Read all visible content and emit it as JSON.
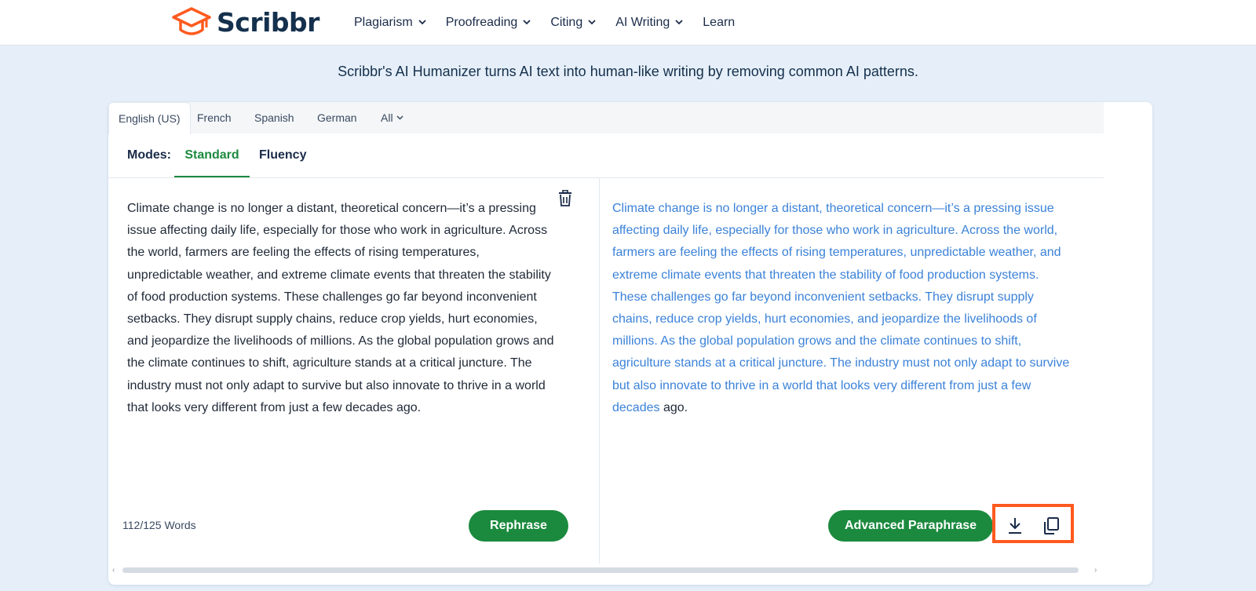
{
  "brand": {
    "name": "Scribbr",
    "accent": "#ff5a1f",
    "navy": "#14304d"
  },
  "nav": {
    "items": [
      {
        "label": "Plagiarism",
        "dropdown": true
      },
      {
        "label": "Proofreading",
        "dropdown": true
      },
      {
        "label": "Citing",
        "dropdown": true
      },
      {
        "label": "AI Writing",
        "dropdown": true
      },
      {
        "label": "Learn",
        "dropdown": false
      }
    ]
  },
  "tagline": "Scribbr's AI Humanizer turns AI text into human-like writing by removing common AI patterns.",
  "languages": {
    "tabs": [
      "English (US)",
      "French",
      "Spanish",
      "German",
      "All"
    ],
    "active": "English (US)"
  },
  "modes": {
    "label": "Modes:",
    "tabs": [
      "Standard",
      "Fluency"
    ],
    "active": "Standard"
  },
  "input": {
    "text": "Climate change is no longer a distant, theoretical concern—it’s a pressing issue affecting daily life, especially for those who work in agriculture. Across the world, farmers are feeling the effects of rising temperatures, unpredictable weather, and extreme climate events that threaten the stability of food production systems. These challenges go far beyond inconvenient setbacks. They disrupt supply chains, reduce crop yields, hurt economies, and jeopardize the livelihoods of millions. As the global population grows and the climate continues to shift, agriculture stands at a critical juncture. The industry must not only adapt to survive but also innovate to thrive in a world that looks very different from just a few decades ago.",
    "word_count": "112/125 Words",
    "rephrase_label": "Rephrase"
  },
  "output": {
    "changed_text": "Climate change is no longer a distant, theoretical concern—it’s a pressing issue affecting daily life, especially for those who work in agriculture. Across the world, farmers are feeling the effects of rising temperatures, unpredictable weather, and extreme climate events that threaten the stability of food production systems. These challenges go far beyond inconvenient setbacks. They disrupt supply chains, reduce crop yields, hurt economies, and jeopardize the livelihoods of millions. As the global population grows and the climate continues to shift, agriculture stands at a critical juncture. The industry must not only adapt to survive but also innovate to thrive in a world that looks very different from just a few decades",
    "unchanged_tail": "ago.",
    "advanced_label": "Advanced Paraphrase",
    "changed_color": "#3b82d8"
  },
  "colors": {
    "green": "#1b8a3e",
    "background": "#e6eff9"
  }
}
